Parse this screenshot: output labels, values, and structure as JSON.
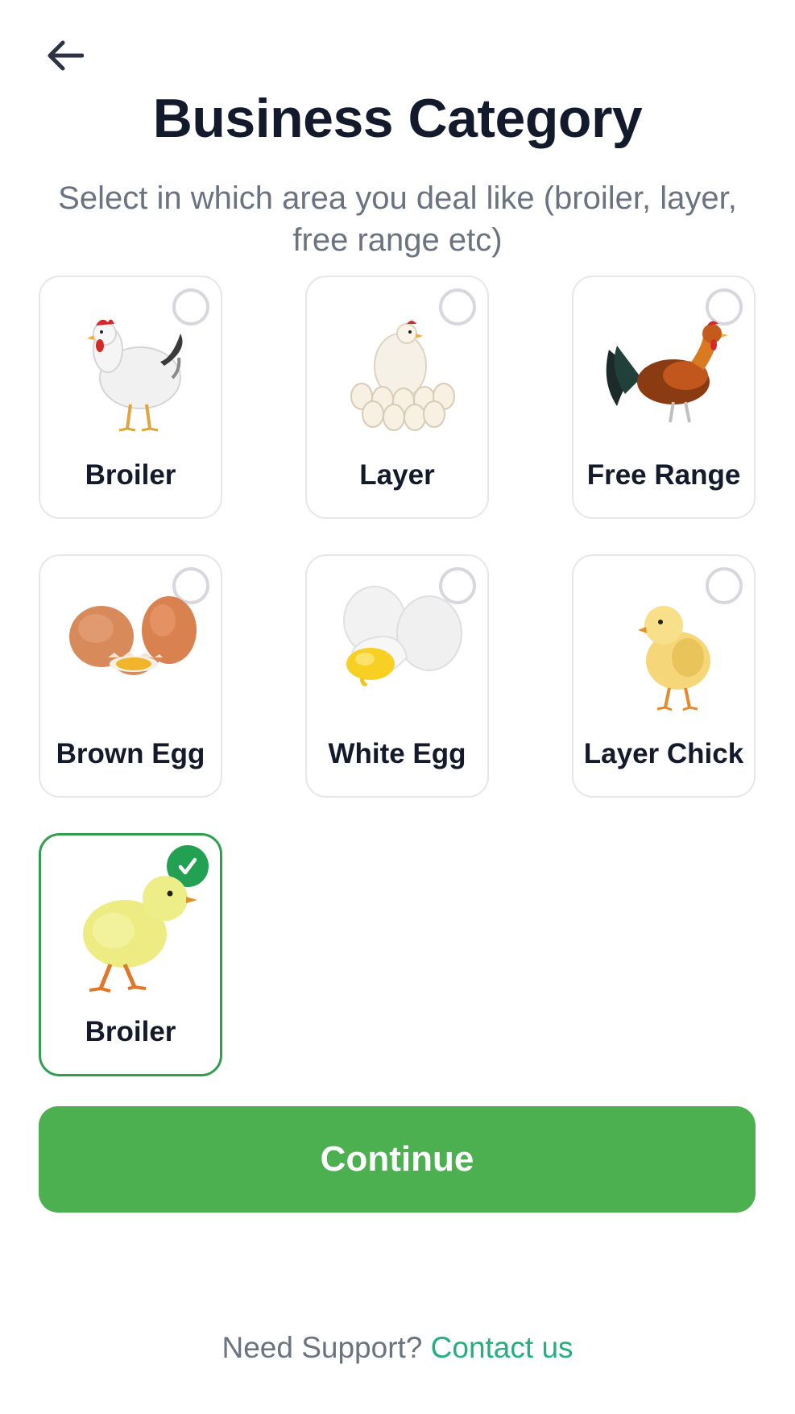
{
  "header": {
    "back_icon": "arrow-left-icon",
    "title": "Business Category",
    "subtitle": "Select in which area you deal like (broiler, layer, free range etc)"
  },
  "categories": [
    {
      "label": "Broiler",
      "image": "white-hen-image",
      "selected": false
    },
    {
      "label": "Layer",
      "image": "hen-with-eggs-image",
      "selected": false
    },
    {
      "label": "Free Range",
      "image": "rooster-image",
      "selected": false
    },
    {
      "label": "Brown Egg",
      "image": "brown-eggs-image",
      "selected": false
    },
    {
      "label": "White Egg",
      "image": "white-eggs-image",
      "selected": false
    },
    {
      "label": "Layer Chick",
      "image": "layer-chick-image",
      "selected": false
    },
    {
      "label": "Broiler",
      "image": "broiler-chick-image",
      "selected": true
    }
  ],
  "continue_label": "Continue",
  "support": {
    "text": "Need Support?",
    "link": "Contact us"
  },
  "colors": {
    "primary_green": "#4caf50",
    "check_green": "#22a153",
    "link_green": "#22b07d",
    "title": "#131a2c",
    "muted": "#6b7280"
  }
}
